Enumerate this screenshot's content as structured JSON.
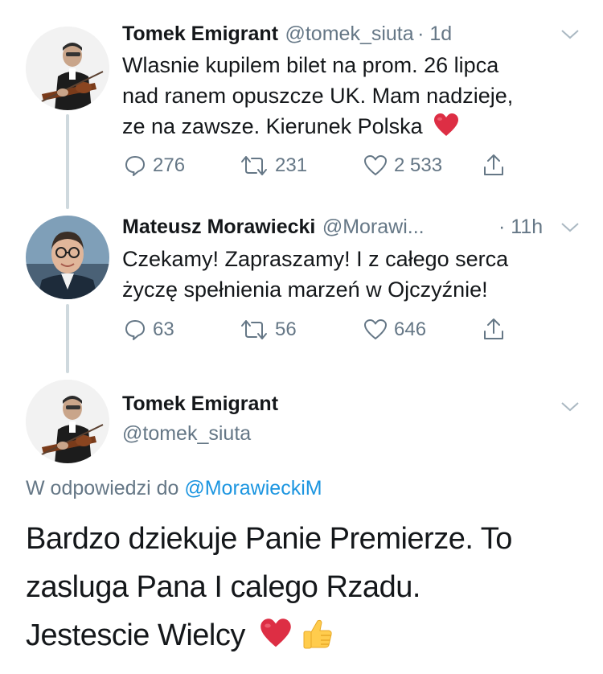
{
  "tweets": [
    {
      "name": "Tomek Emigrant",
      "handle": "@tomek_siuta",
      "time": "· 1d",
      "lines": [
        "Wlasnie kupilem bilet na prom. 26 lipca",
        "nad ranem opuszcze UK. Mam nadzieje,",
        "ze na zawsze. Kierunek Polska"
      ],
      "emoji": "red-heart",
      "replies": "276",
      "retweets": "231",
      "likes": "2 533"
    },
    {
      "name": "Mateusz Morawiecki",
      "handle": "@Morawi...",
      "time": "· 11h",
      "lines": [
        "Czekamy! Zapraszamy! I z całego serca",
        "życzę spełnienia marzeń w Ojczyźnie!"
      ],
      "replies": "63",
      "retweets": "56",
      "likes": "646"
    }
  ],
  "focused": {
    "name": "Tomek Emigrant",
    "handle": "@tomek_siuta",
    "reply_prefix": "W odpowiedzi do",
    "reply_to": "@MorawieckiM",
    "lines": [
      "Bardzo dziekuje Panie Premierze. To",
      "zasluga Pana I calego Rzadu.",
      "Jestescie Wielcy"
    ],
    "emoji": [
      "red-heart",
      "thumbs-up"
    ]
  },
  "colors": {
    "text": "#14171a",
    "secondary": "#657786",
    "link": "#1b95e0",
    "thread_line": "#cfd9de",
    "heart": "#e0245e"
  },
  "icons": [
    "reply-icon",
    "retweet-icon",
    "like-icon",
    "share-icon",
    "chevron-down-icon"
  ]
}
